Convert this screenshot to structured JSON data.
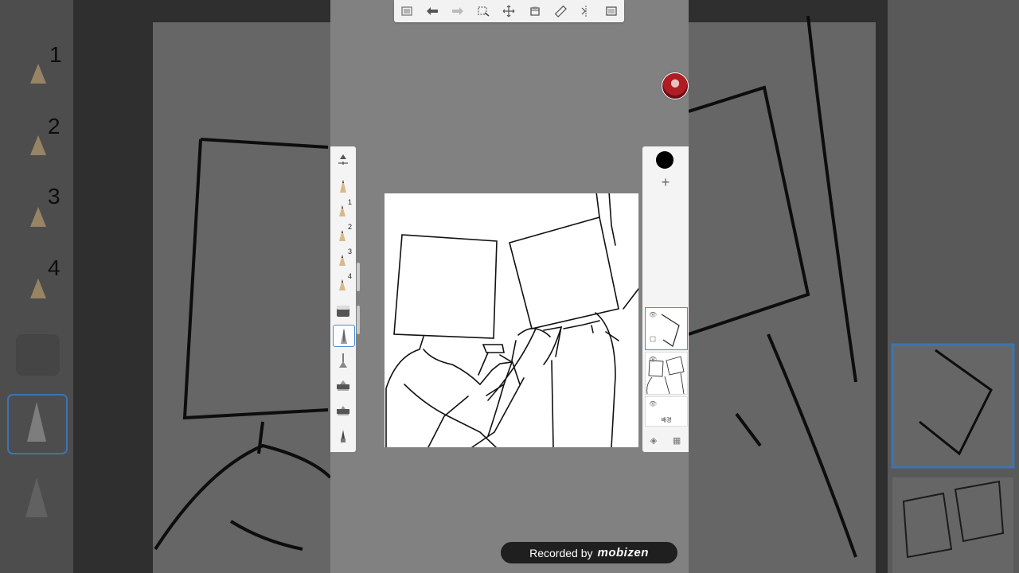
{
  "toolbar": {
    "items": [
      {
        "name": "menu-icon"
      },
      {
        "name": "undo-icon"
      },
      {
        "name": "redo-icon"
      },
      {
        "name": "selection-icon"
      },
      {
        "name": "move-icon"
      },
      {
        "name": "fill-icon"
      },
      {
        "name": "ruler-icon"
      },
      {
        "name": "symmetry-icon"
      },
      {
        "name": "fullscreen-icon"
      }
    ]
  },
  "brushes": {
    "items": [
      {
        "name": "brush-settings-icon",
        "label": ""
      },
      {
        "name": "pencil-icon",
        "label": ""
      },
      {
        "name": "pencil-1-icon",
        "label": "1"
      },
      {
        "name": "pencil-2-icon",
        "label": "2"
      },
      {
        "name": "pencil-3-icon",
        "label": "3"
      },
      {
        "name": "pencil-4-icon",
        "label": "4"
      },
      {
        "name": "eraser-icon",
        "label": ""
      },
      {
        "name": "pen-icon",
        "label": ""
      },
      {
        "name": "airbrush-icon",
        "label": ""
      },
      {
        "name": "marker-icon",
        "label": ""
      },
      {
        "name": "marker-2-icon",
        "label": ""
      },
      {
        "name": "brush-tip-icon",
        "label": ""
      }
    ],
    "selected_index": 7
  },
  "left_zoom": {
    "labels": [
      "1",
      "2",
      "3",
      "4"
    ]
  },
  "layers": {
    "current_color": "#000000",
    "add_symbol": "+",
    "background_label": "배경",
    "eye_symbol": "👁"
  },
  "recorder": {
    "prefix": "Recorded by",
    "brand": "mobizen"
  },
  "colors": {
    "accent": "#4a8fd9",
    "screen_bg": "#818181",
    "panel_bg": "#f4f4f4"
  }
}
